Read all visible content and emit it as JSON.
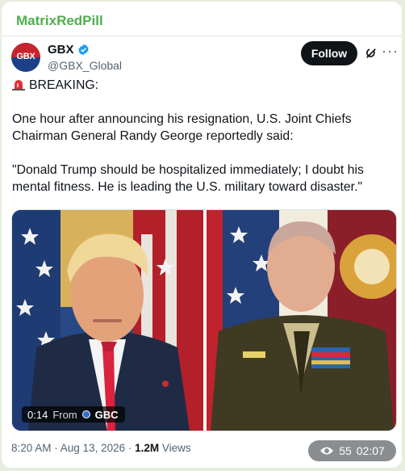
{
  "channel": {
    "name": "MatrixRedPill",
    "accent": "#4fae4e"
  },
  "tweet": {
    "author_name": "GBX",
    "avatar_text": "GBX",
    "handle": "@GBX_Global",
    "follow_label": "Follow",
    "icons": {
      "verified": "verified-badge-icon",
      "grok": "grok-icon",
      "more": "more-options-icon"
    },
    "breaking": "BREAKING:",
    "paragraph1": "One hour after announcing his resignation, U.S. Joint Chiefs Chairman General Randy George reportedly said:",
    "paragraph2": "\"Donald Trump should be hospitalized immediately; I doubt his mental fitness. He is leading the U.S. military toward disaster.\"",
    "video": {
      "duration": "0:14",
      "from_label": "From",
      "source": "GBC"
    },
    "timestamp": "8:20 AM · Aug 13, 2026 ·",
    "views_count": "1.2M",
    "views_label": "Views"
  },
  "telegram": {
    "views": "55",
    "time": "02:07"
  }
}
